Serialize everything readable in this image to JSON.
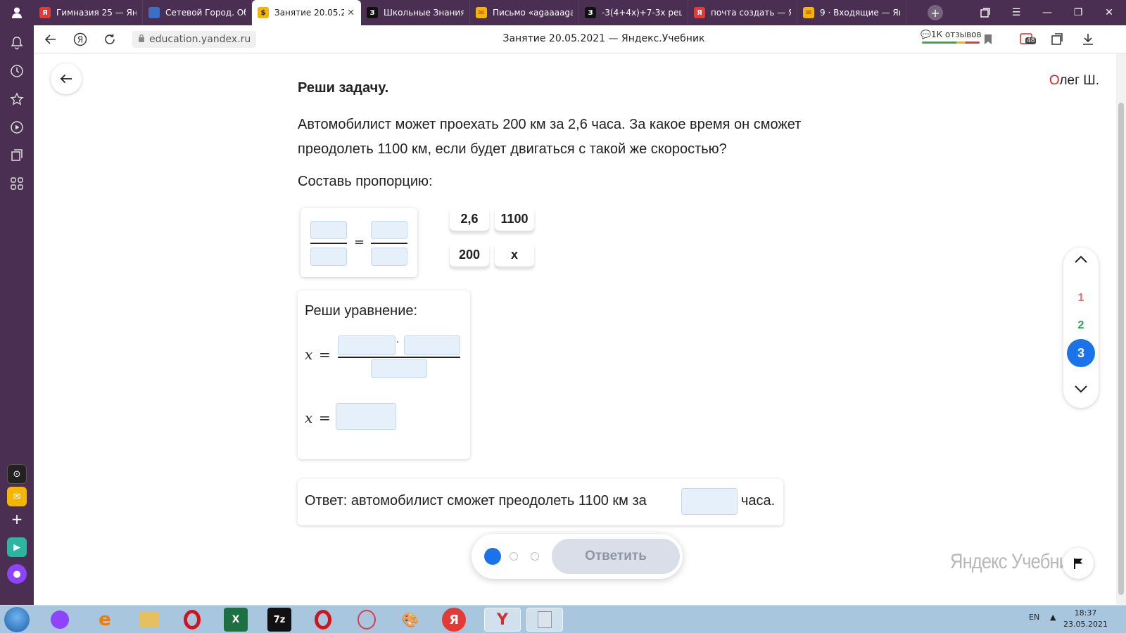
{
  "browser": {
    "tabs": [
      {
        "title": "Гимназия 25 — Ян",
        "fav": "Я",
        "color": "#e53935"
      },
      {
        "title": "Сетевой Город. Об",
        "fav": "",
        "color": "#3a6fc4"
      },
      {
        "title": "Занятие 20.05.2",
        "fav": "$",
        "color": "#f2b600"
      },
      {
        "title": "Школьные Знания",
        "fav": "З",
        "color": "#111111"
      },
      {
        "title": "Письмо «agaaaaga",
        "fav": "✉",
        "color": "#f2b600"
      },
      {
        "title": "-3(4+4x)+7-3x реш",
        "fav": "З",
        "color": "#111111"
      },
      {
        "title": "почта создать — Я",
        "fav": "Я",
        "color": "#e53935"
      },
      {
        "title": "9 · Входящие — Ян",
        "fav": "✉",
        "color": "#f2b600"
      }
    ],
    "url": "education.yandex.ru",
    "page_title": "Занятие 20.05.2021 — Яндекс.Учебник",
    "reviews": "1К отзывов",
    "badge_count": "48"
  },
  "page": {
    "user_initial": "О",
    "user_rest": "лег Ш.",
    "task_title": "Реши задачу.",
    "task_line1": "Автомобилист может проехать 200 км за 2,6 часа. За какое время он сможет",
    "task_line2": "преодолеть 1100 км, если будет двигаться с такой же скоростью?",
    "proportion_label": "Составь пропорцию:",
    "equals": "=",
    "chips": [
      "2,6",
      "1100",
      "200",
      "x"
    ],
    "solve_title": "Реши уравнение:",
    "var_x": "x",
    "eq_sign": "=",
    "mult_dot": "·",
    "answer_prefix": "Ответ: автомобилист сможет преодолеть 1100 км за",
    "answer_suffix": "часа.",
    "submit_label": "Ответить",
    "question_nav": [
      "1",
      "2",
      "3"
    ],
    "brand": "Яндекс Учебник"
  },
  "taskbar": {
    "lang": "EN",
    "time": "18:37",
    "date": "23.05.2021"
  },
  "colors": {
    "accent": "#1a73e8",
    "q1": "#ef6a6a",
    "q2": "#2ca05a",
    "browser_chrome": "#4a2f52"
  }
}
